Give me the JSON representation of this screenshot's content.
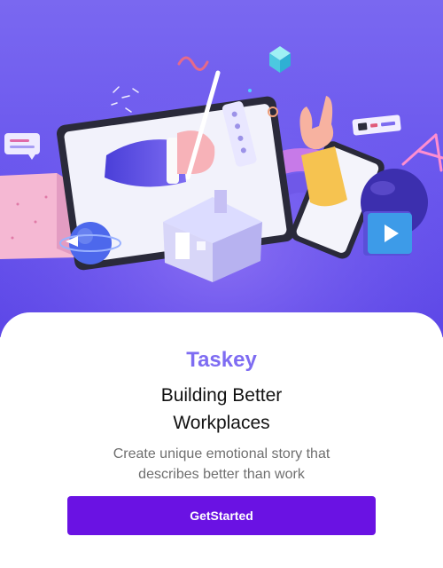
{
  "app": {
    "name": "Taskey"
  },
  "onboarding": {
    "headline_lines": [
      "Building Better",
      "Workplaces"
    ],
    "subtitle_lines": [
      "Create unique emotional story that",
      "describes better than work"
    ],
    "cta_label": "GetStarted"
  },
  "colors": {
    "hero_background": "#6c59ee",
    "brand": "#7e6cf2",
    "cta_background": "#6a12e3",
    "cta_text": "#ffffff"
  },
  "icons": [
    "tablet-illustration",
    "house-icon",
    "phone-illustration",
    "play-icon",
    "globe-icon",
    "cube-icon"
  ]
}
